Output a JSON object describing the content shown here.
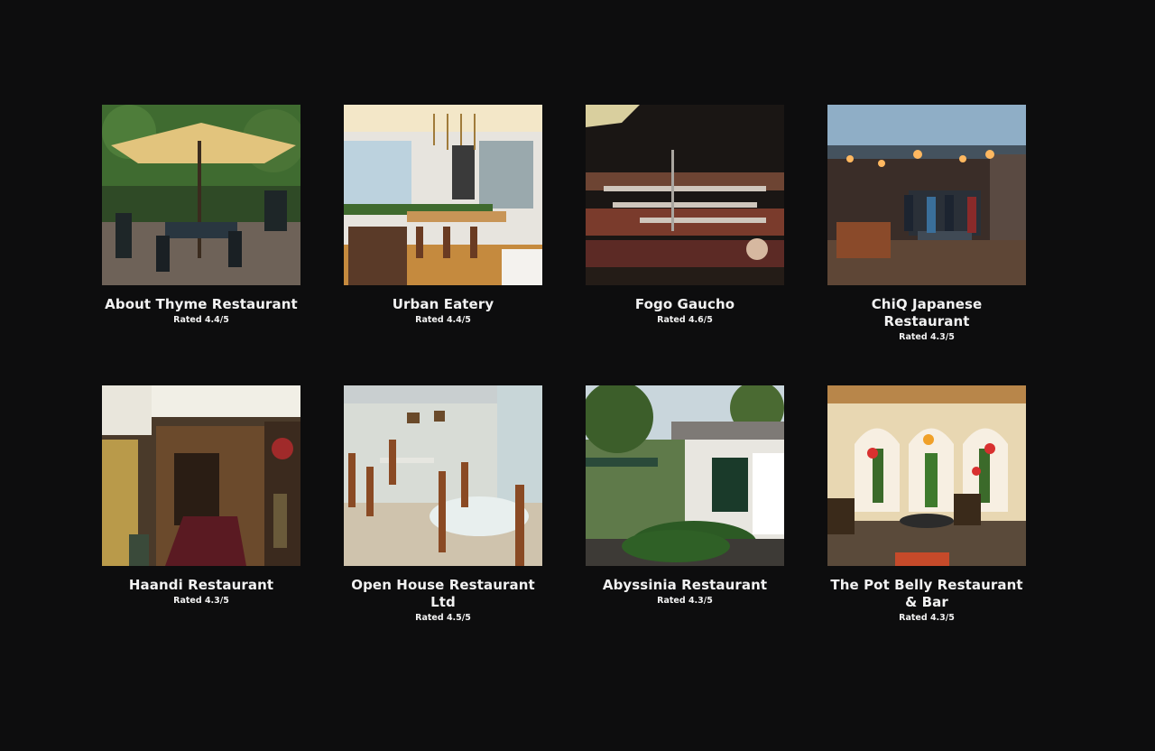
{
  "restaurants": [
    {
      "name": "About Thyme Restaurant",
      "rating": "Rated 4.4/5",
      "photo": "outdoor-umbrella-terrace-photo"
    },
    {
      "name": "Urban Eatery",
      "rating": "Rated 4.4/5",
      "photo": "modern-dining-room-photo"
    },
    {
      "name": "Fogo Gaucho",
      "rating": "Rated 4.6/5",
      "photo": "grill-skewers-photo"
    },
    {
      "name": "ChiQ Japanese Restaurant",
      "rating": "Rated 4.3/5",
      "photo": "japanese-dining-room-photo"
    },
    {
      "name": "Haandi Restaurant",
      "rating": "Rated 4.3/5",
      "photo": "restaurant-entrance-photo"
    },
    {
      "name": "Open House Restaurant Ltd",
      "rating": "Rated 4.5/5",
      "photo": "indoor-dining-tables-photo"
    },
    {
      "name": "Abyssinia Restaurant",
      "rating": "Rated 4.3/5",
      "photo": "garden-building-photo"
    },
    {
      "name": "The Pot Belly Restaurant & Bar",
      "rating": "Rated 4.3/5",
      "photo": "cactus-mural-interior-photo"
    }
  ]
}
